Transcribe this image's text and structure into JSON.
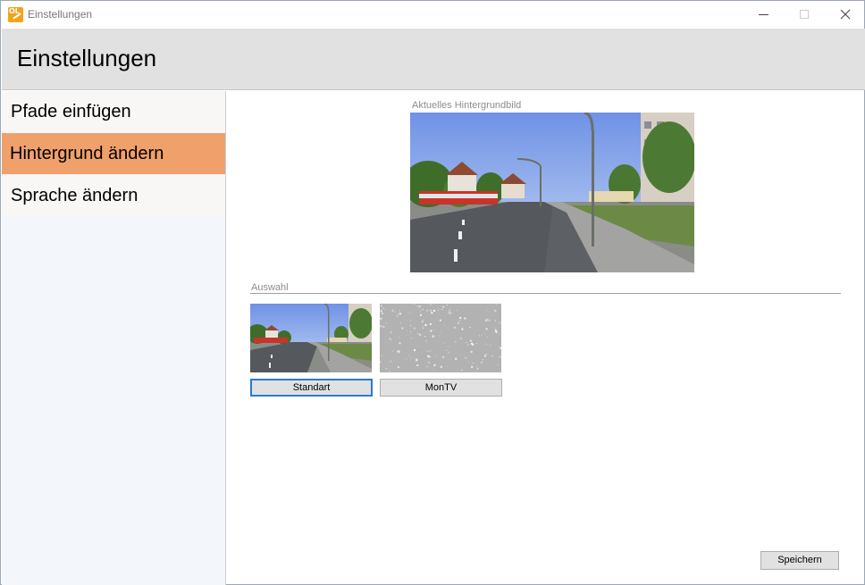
{
  "window": {
    "title": "Einstellungen",
    "app_icon": "omsi-ol-icon"
  },
  "header": {
    "title": "Einstellungen"
  },
  "sidebar": {
    "items": [
      {
        "label": "Pfade einfügen",
        "active": false
      },
      {
        "label": "Hintergrund ändern",
        "active": true
      },
      {
        "label": "Sprache ändern",
        "active": false
      }
    ]
  },
  "main": {
    "current_background_label": "Aktuelles Hintergrundbild",
    "selection_label": "Auswahl",
    "options": [
      {
        "label": "Standart",
        "selected": true,
        "thumbnail": "street-scene"
      },
      {
        "label": "MonTV",
        "selected": false,
        "thumbnail": "tv-static-noise"
      }
    ],
    "save_label": "Speichern"
  },
  "colors": {
    "active_nav": "#f0a06b",
    "header_bg": "#e1e1e1",
    "sidebar_bg": "#f3f6fb",
    "selected_border": "#2a7ad4"
  }
}
